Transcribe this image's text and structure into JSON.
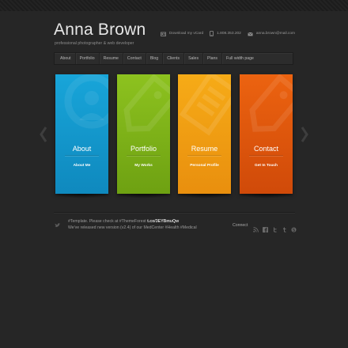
{
  "header": {
    "name": "Anna Brown",
    "tagline": "professional photographer & web developer",
    "vcard": "Download my vCard",
    "phone": "1.808.353.202",
    "email": "anna.brown@mail.com"
  },
  "nav": {
    "items": [
      "About",
      "Portfolio",
      "Resume",
      "Contact",
      "Blog",
      "Clients",
      "Sales",
      "Plans",
      "Full width page"
    ]
  },
  "cards": [
    {
      "title": "About",
      "subtitle": "About Me",
      "color": "#18a5d9",
      "icon": "user-icon"
    },
    {
      "title": "Portfolio",
      "subtitle": "My Works",
      "color": "#8dc21f",
      "icon": "tag-icon"
    },
    {
      "title": "Resume",
      "subtitle": "Personal Profile",
      "color": "#f6ab17",
      "icon": "pencil-icon"
    },
    {
      "title": "Contact",
      "subtitle": "Get In Touch",
      "color": "#ec6310",
      "icon": "tag-icon"
    }
  ],
  "footer": {
    "tweet1_text": "#Template. Please check at #ThemeForest",
    "tweet1_link": "t.co/3EYBmuQw",
    "tweet2_text": "We've released new version (v2.4) of our MedCenter #Health #Medical",
    "connect_label": "Connect",
    "social_icons": [
      "rss-icon",
      "facebook-icon",
      "twitter-icon",
      "tumblr-icon",
      "skype-icon"
    ]
  }
}
